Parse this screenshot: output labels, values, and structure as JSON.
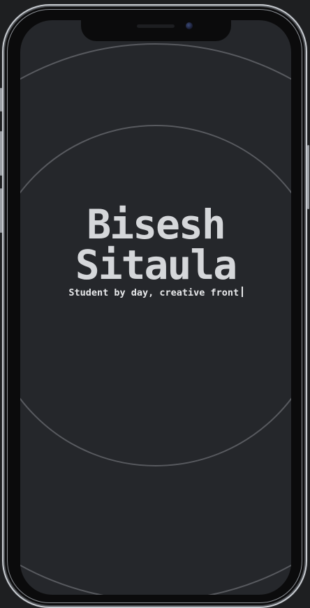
{
  "hero": {
    "first_name": "Bisesh",
    "last_name": "Sitaula",
    "tagline": "Student by day, creative front"
  },
  "colors": {
    "screen_background": "#25272b",
    "title_text": "#d5d7da",
    "tagline_text": "#e7e8ea",
    "ring_stroke": "#969aa0"
  },
  "icons": {
    "camera": "front-camera-icon",
    "speaker": "earpiece-speaker-icon"
  }
}
